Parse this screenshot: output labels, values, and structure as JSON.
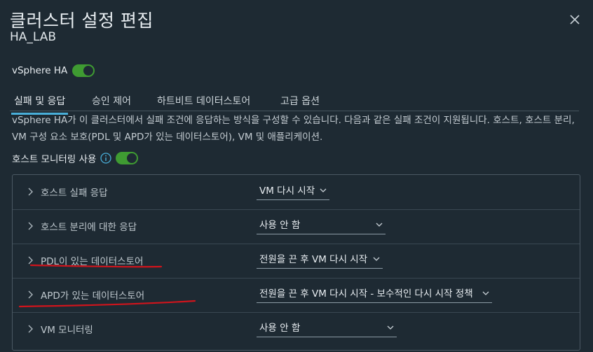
{
  "dialog": {
    "title": "클러스터 설정 편집",
    "subtitle": "HA_LAB"
  },
  "vsphere_ha": {
    "label": "vSphere HA",
    "enabled": true
  },
  "tabs": [
    {
      "label": "실패 및 응답",
      "active": true
    },
    {
      "label": "승인 제어",
      "active": false
    },
    {
      "label": "하트비트 데이터스토어",
      "active": false
    },
    {
      "label": "고급 옵션",
      "active": false
    }
  ],
  "description": "vSphere HA가 이 클러스터에서 실패 조건에 응답하는 방식을 구성할 수 있습니다. 다음과 같은 실패 조건이 지원됩니다. 호스트, 호스트 분리, VM 구성 요소 보호(PDL 및 APD가 있는 데이터스토어), VM 및 애플리케이션.",
  "host_monitoring": {
    "label": "호스트 모니터링 사용",
    "enabled": true
  },
  "failure_rows": [
    {
      "label": "호스트 실패 응답",
      "value": "VM 다시 시작"
    },
    {
      "label": "호스트 분리에 대한 응답",
      "value": "사용 안 함"
    },
    {
      "label": "PDL이 있는 데이터스토어",
      "value": "전원을 끈 후 VM 다시 시작"
    },
    {
      "label": "APD가 있는 데이터스토어",
      "value": "전원을 끈 후 VM 다시 시작 - 보수적인 다시 시작 정책"
    },
    {
      "label": "VM 모니터링",
      "value": "사용 안 함"
    }
  ],
  "colors": {
    "background": "#1e2a33",
    "toggle_on": "#3f9b32",
    "tab_active": "#49afd9",
    "annotation": "#d0141c"
  },
  "icons": [
    "close-icon",
    "info-icon",
    "chevron-right-icon",
    "caret-down-icon"
  ]
}
